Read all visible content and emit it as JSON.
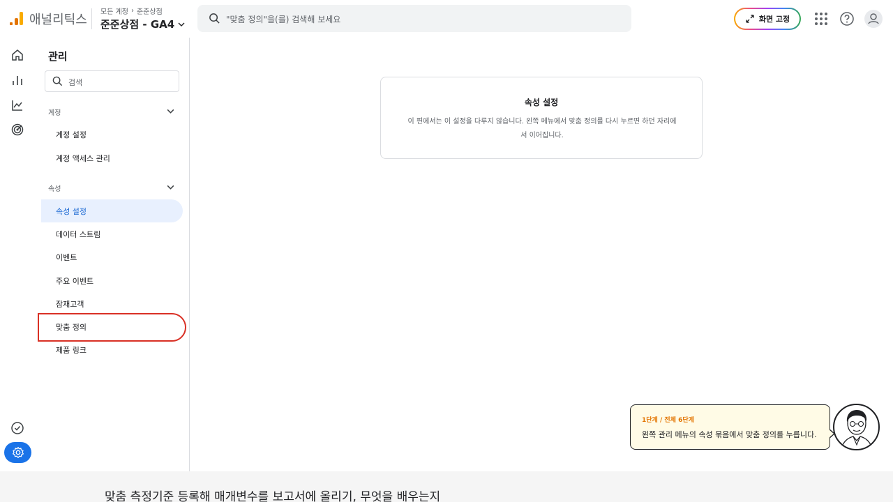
{
  "header": {
    "app_name": "애널리틱스",
    "breadcrumb_all": "모든 계정",
    "breadcrumb_sep": "›",
    "breadcrumb_account": "준준상점",
    "property_name": "준준상점 - GA4",
    "search_placeholder": "\"맞춤 정의\"을(를) 검색해 보세요",
    "fullscreen_label": "화면 고정"
  },
  "admin": {
    "title": "관리",
    "search_placeholder": "검색",
    "account_section": "계정",
    "account_items": [
      "계정 설정",
      "계정 액세스 관리"
    ],
    "property_section": "속성",
    "property_items": [
      "속성 설정",
      "데이터 스트림",
      "이벤트",
      "주요 이벤트",
      "잠재고객",
      "맞춤 정의",
      "제품 링크"
    ],
    "active_item": "속성 설정",
    "highlighted_item": "맞춤 정의"
  },
  "card": {
    "title": "속성 설정",
    "body": "이 편에서는 이 설정을 다루지 않습니다. 왼쪽 메뉴에서 맞춤 정의를 다시 누르면 하던 자리에서 이어집니다."
  },
  "tooltip": {
    "step": "1단계 / 전체 6단계",
    "text": "왼쪽 관리 메뉴의 속성 묶음에서 맞춤 정의를 누릅니다."
  },
  "caption": "맞춤 측정기준 등록해 매개변수를 보고서에 올리기, 무엇을 배우는지",
  "colors": {
    "accent": "#1a73e8",
    "active_bg": "#e8f0fe",
    "highlight": "#d93025",
    "step_text": "#e37400",
    "tooltip_bg": "#fffbe6"
  }
}
